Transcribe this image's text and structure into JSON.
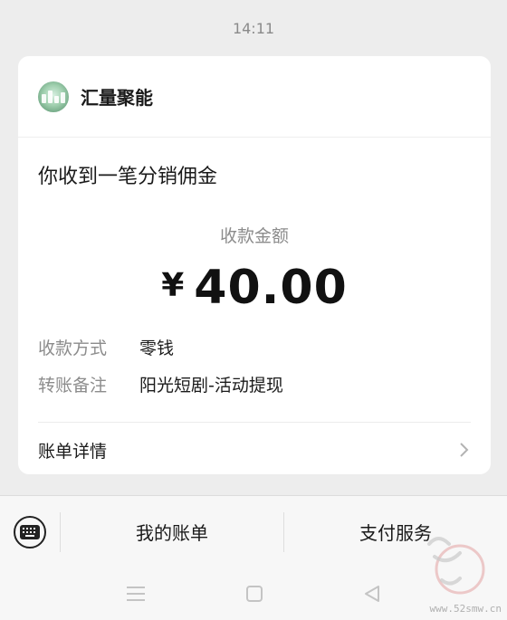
{
  "chat": {
    "timestamp": "14:11"
  },
  "card": {
    "app_name": "汇量聚能",
    "headline": "你收到一笔分销佣金",
    "amount_label": "收款金额",
    "currency_symbol": "¥",
    "amount": "40.00",
    "details": [
      {
        "key": "收款方式",
        "value": "零钱"
      },
      {
        "key": "转账备注",
        "value": "阳光短剧-活动提现"
      }
    ],
    "bill_link": "账单详情"
  },
  "bottom_menu": {
    "items": [
      "我的账单",
      "支付服务"
    ]
  },
  "watermark": {
    "text": "www.52smw.cn"
  },
  "colors": {
    "background": "#ededed",
    "card": "#ffffff",
    "secondary_text": "#8c8c8c",
    "primary_text": "#1a1a1a"
  },
  "icons": [
    "app-logo-icon",
    "chevron-right-icon",
    "keyboard-icon",
    "nav-menu-icon",
    "nav-home-icon",
    "nav-back-icon"
  ]
}
